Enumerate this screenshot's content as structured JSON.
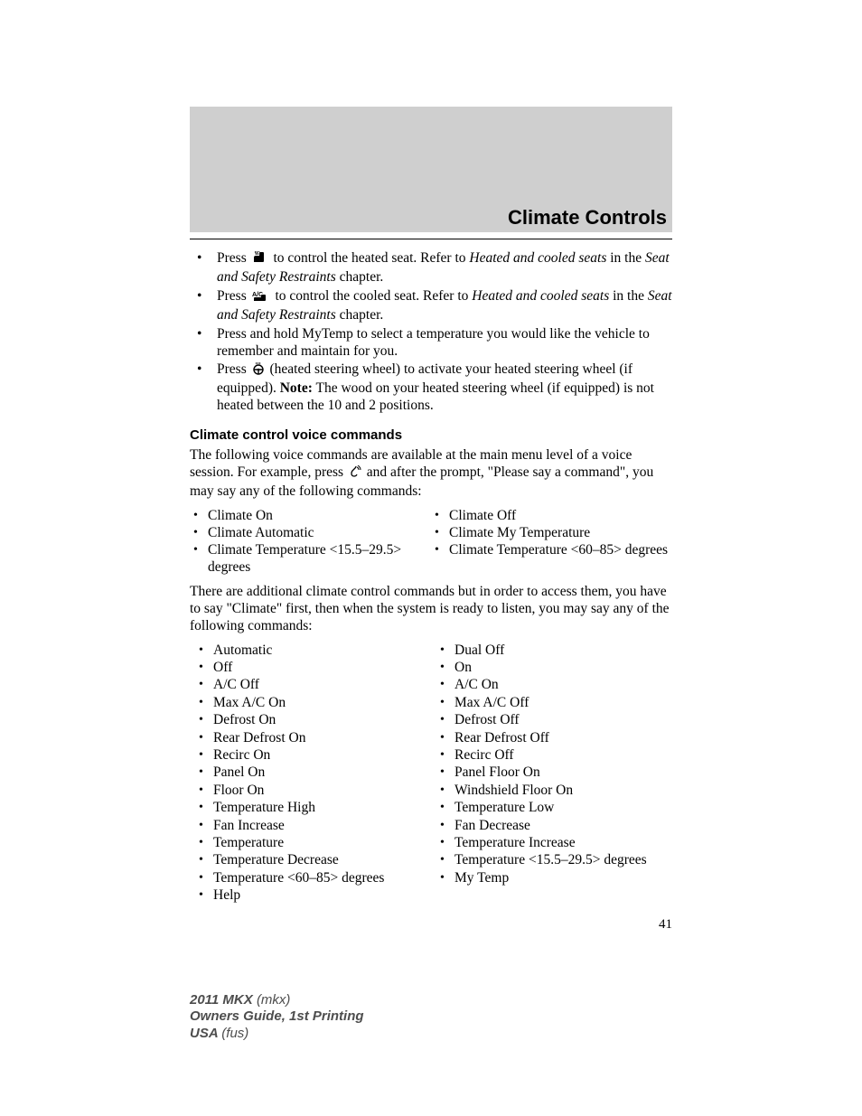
{
  "pageTitle": "Climate Controls",
  "pageNumber": "41",
  "footer": {
    "l1b": "2011 MKX ",
    "l1i": "(mkx)",
    "l2": "Owners Guide, 1st Printing",
    "l3b": "USA ",
    "l3i": "(fus)"
  },
  "bullets": {
    "b1a": "Press ",
    "b1b": " to control the heated seat. Refer to ",
    "b1_it": "Heated and cooled seats",
    "b1c": " in the ",
    "b1_it2": "Seat and Safety Restraints",
    "b1d": " chapter.",
    "b2a": "Press ",
    "b2b": " to control the cooled seat. Refer to ",
    "b2_it": "Heated and cooled seats",
    "b2c": " in the ",
    "b2_it2": "Seat and Safety Restraints",
    "b2d": " chapter.",
    "b3": "Press and hold MyTemp to select a temperature you would like the vehicle to remember and maintain for you.",
    "b4a": "Press ",
    "b4b": " (heated steering wheel) to activate your heated steering wheel (if equipped). ",
    "b4_note": "Note:",
    "b4c": " The wood on your heated steering wheel (if equipped) is not heated between the 10 and 2 positions."
  },
  "subheading": "Climate control voice commands",
  "para1a": "The following voice commands are available at the main menu level of a voice session. For example, press ",
  "para1b": " and after the prompt, \"Please say a command\", you may say any of the following commands:",
  "voiceGroup1": {
    "left": [
      "Climate On",
      "Climate Automatic",
      "Climate Temperature <15.5–29.5> degrees"
    ],
    "right": [
      "Climate Off",
      "Climate My Temperature",
      "Climate Temperature <60–85> degrees"
    ]
  },
  "para2": "There are additional climate control commands but in order to access them, you have to say \"Climate\" first, then when the system is ready to listen, you may say any of the following commands:",
  "voiceGroup2": {
    "left": [
      "Automatic",
      "Off",
      "A/C Off",
      "Max A/C On",
      "Defrost On",
      "Rear Defrost On",
      "Recirc On",
      "Panel On",
      "Floor On",
      "Temperature High",
      "Fan Increase",
      "Temperature",
      "Temperature Decrease",
      "Temperature <60–85> degrees",
      "Help"
    ],
    "right": [
      "Dual Off",
      "On",
      "A/C On",
      "Max A/C Off",
      "Defrost Off",
      "Rear Defrost Off",
      "Recirc Off",
      "Panel Floor On",
      "Windshield Floor On",
      "Temperature Low",
      "Fan Decrease",
      "Temperature Increase",
      "Temperature <15.5–29.5> degrees",
      "My Temp"
    ]
  },
  "icons": {
    "heatedSeat": "heated-seat-icon",
    "cooledSeat": "cooled-seat-icon",
    "steeringWheel": "heated-steering-wheel-icon",
    "voice": "voice-icon"
  }
}
